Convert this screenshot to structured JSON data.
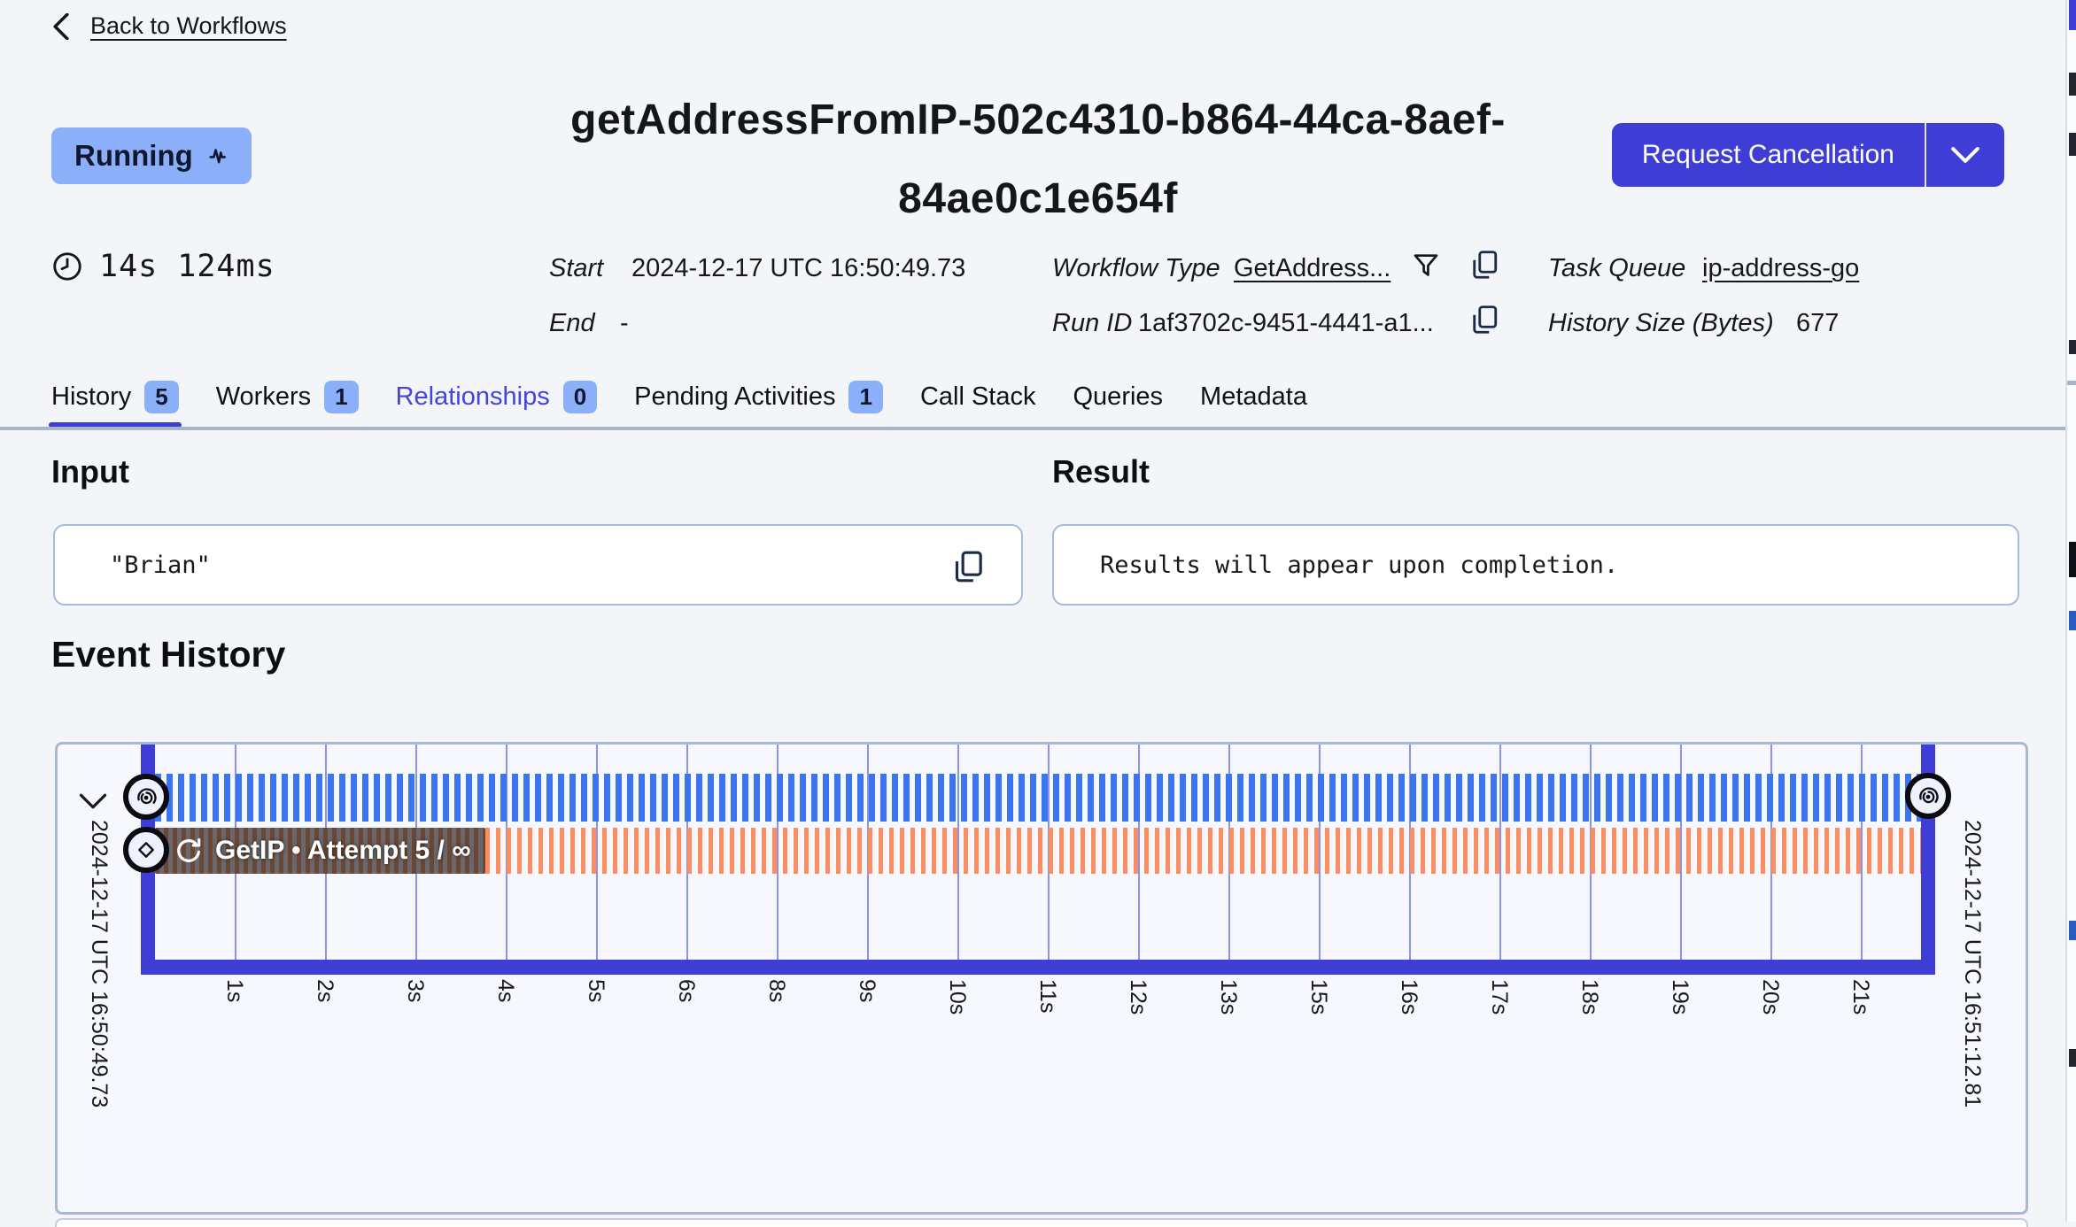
{
  "colors": {
    "page-bg": "#f4f5f9",
    "accent": "#3e3ed6",
    "status-blue": "#8bb0f9",
    "link-blue": "#4543de",
    "stripe-blue": "#3b76f0",
    "stripe-orange": "#fb8d60",
    "box-brown": "#6b4733",
    "box-gray": "#68686e",
    "grid-line": "#8a93e8",
    "panel-border": "#a9b8d4",
    "field-border": "#a6bcdc",
    "divider": "#a8b4c8",
    "icon-dark": "#1c2b4a"
  },
  "header": {
    "back_label": "Back to Workflows",
    "title": "getAddressFromIP-502c4310-b864-44ca-8aef-84ae0c1e654f",
    "status_label": "Running",
    "cancel_label": "Request Cancellation"
  },
  "details": {
    "duration": "14s 124ms",
    "start_label": "Start",
    "start_value": "2024-12-17 UTC 16:50:49.73",
    "end_label": "End",
    "end_value": "-",
    "workflow_type_label": "Workflow Type",
    "workflow_type_value": "GetAddress...",
    "run_id_label": "Run ID",
    "run_id_value": "1af3702c-9451-4441-a1...",
    "task_queue_label": "Task Queue",
    "task_queue_value": "ip-address-go",
    "history_size_label": "History Size (Bytes)",
    "history_size_value": "677"
  },
  "tabs": [
    {
      "label": "History",
      "count": "5",
      "active": true
    },
    {
      "label": "Workers",
      "count": "1"
    },
    {
      "label": "Relationships",
      "count": "0",
      "accent": true
    },
    {
      "label": "Pending Activities",
      "count": "1"
    },
    {
      "label": "Call Stack"
    },
    {
      "label": "Queries"
    },
    {
      "label": "Metadata"
    }
  ],
  "input": {
    "heading": "Input",
    "value": "\"Brian\""
  },
  "result": {
    "heading": "Result",
    "value": "Results will appear upon completion."
  },
  "event_history": {
    "heading": "Event History",
    "start_time": "2024-12-17 UTC 16:50:49.73",
    "end_time": "2024-12-17 UTC 16:51:12.81",
    "activity_label": "GetIP • Attempt 5 / ∞",
    "ticks": [
      "1s",
      "2s",
      "3s",
      "4s",
      "5s",
      "6s",
      "8s",
      "9s",
      "10s",
      "11s",
      "12s",
      "13s",
      "15s",
      "16s",
      "17s",
      "18s",
      "19s",
      "20s",
      "21s"
    ]
  },
  "chart_data": {
    "type": "timeline",
    "title": "Event History",
    "x_start": "2024-12-17 UTC 16:50:49.73",
    "x_end": "2024-12-17 UTC 16:51:12.81",
    "tick_labels": [
      "1s",
      "2s",
      "3s",
      "4s",
      "5s",
      "6s",
      "8s",
      "9s",
      "10s",
      "11s",
      "12s",
      "13s",
      "15s",
      "16s",
      "17s",
      "18s",
      "19s",
      "20s",
      "21s"
    ],
    "rows": [
      {
        "name": "workflow-execution",
        "style": "blue-striped",
        "span": "full"
      },
      {
        "name": "GetIP • Attempt 5 / ∞",
        "style": "orange-striped-pending",
        "span": "full"
      }
    ]
  }
}
